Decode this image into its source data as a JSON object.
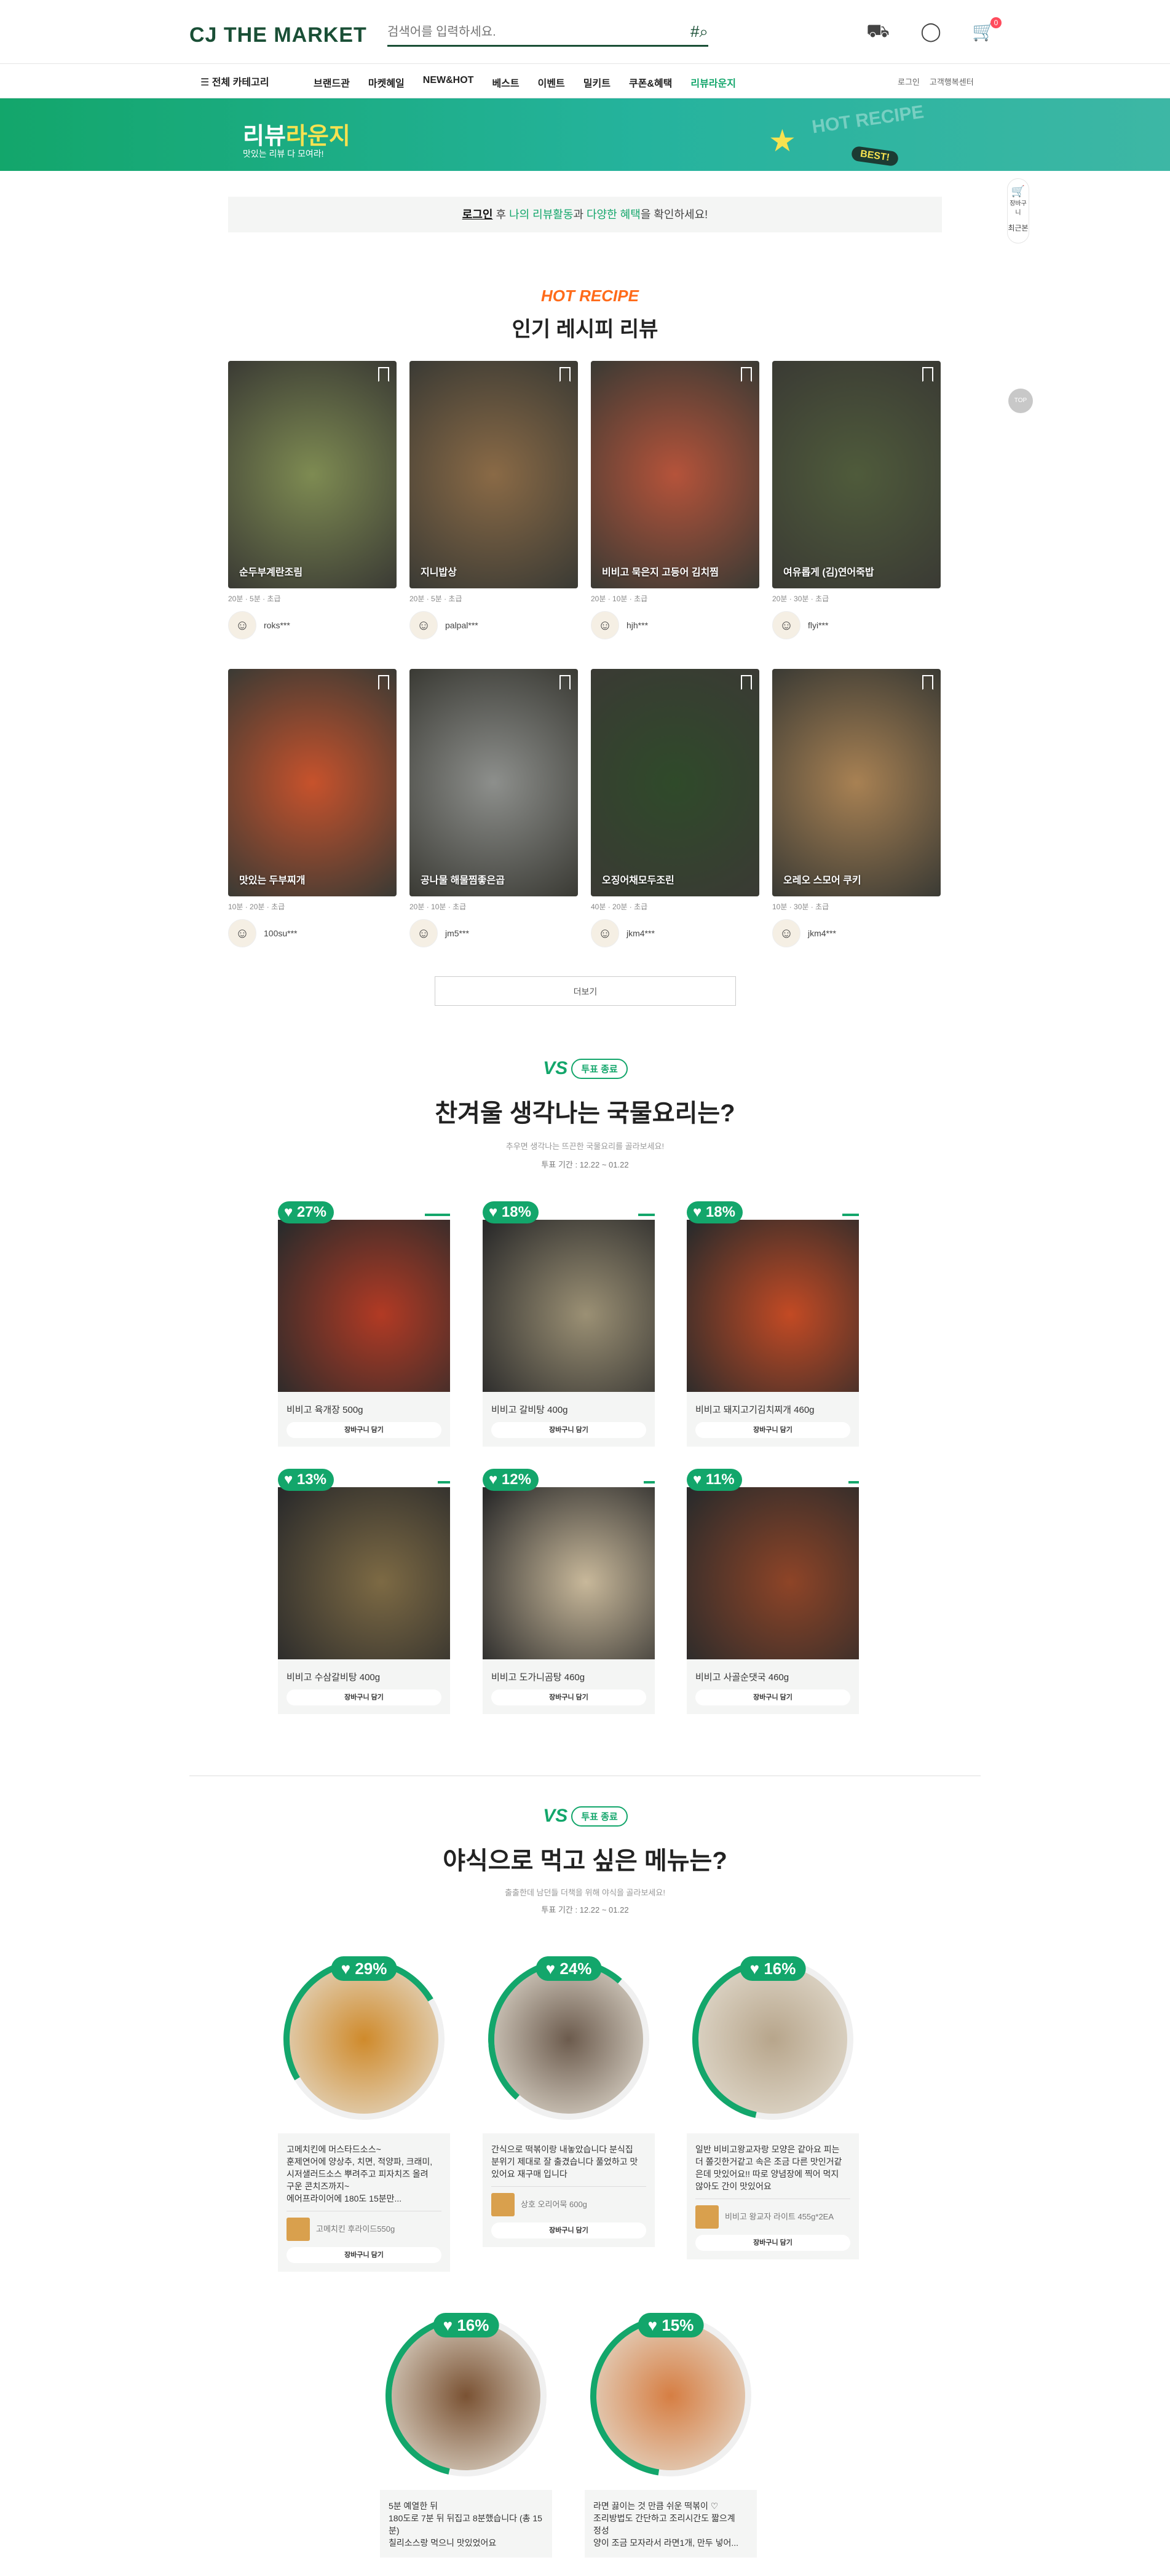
{
  "header": {
    "logo": "CJ THE MARKET",
    "search_placeholder": "검색어를 입력하세요.",
    "cart_count": "0",
    "recent_label": "최근"
  },
  "gnb": {
    "all": "전체 카테고리",
    "menu": [
      "브랜드관",
      "마켓혜일",
      "NEW&HOT",
      "베스트",
      "이벤트",
      "밀키트",
      "쿠폰&혜택"
    ],
    "lounge": "리뷰라운지",
    "login": "로그인",
    "cs": "고객행복센터"
  },
  "banner": {
    "title_a": "리뷰",
    "title_b": "라운지",
    "subtitle": "맛있는 리뷰 다 모여라!",
    "hot": "HOT RECIPE",
    "best": "BEST!"
  },
  "quick": {
    "cart": "장바구니",
    "recent": "최근본",
    "top": "TOP"
  },
  "login_bar": {
    "link": "로그인",
    "t1": "후 ",
    "g1": "나의 리뷰활동",
    "t2": "과 ",
    "g2": "다양한 혜택",
    "t3": "을 확인하세요!"
  },
  "recipe": {
    "hot": "HOT RECIPE",
    "title": "인기 레시피 리뷰",
    "more": "더보기",
    "items": [
      {
        "name": "순두부계란조림",
        "meta": "20분 · 5분 · 초급",
        "user": "roks***",
        "color": "#7e8b52"
      },
      {
        "name": "지니밥상",
        "meta": "20분 · 5분 · 초급",
        "user": "palpal***",
        "color": "#8a6a46"
      },
      {
        "name": "비비고 묵은지 고등어 김치찜",
        "meta": "20분 · 10분 · 초급",
        "user": "hjh***",
        "color": "#b5533a"
      },
      {
        "name": "여유롭게 (김)연어죽밥",
        "meta": "20분 · 30분 · 초급",
        "user": "flyi***",
        "color": "#4f5b3b"
      },
      {
        "name": "맛있는 두부찌개",
        "meta": "10분 · 20분 · 초급",
        "user": "100su***",
        "color": "#c7522c"
      },
      {
        "name": "공나물 해물찜좋은곱",
        "meta": "20분 · 10분 · 초급",
        "user": "jm5***",
        "color": "#8d8f8c"
      },
      {
        "name": "오징어채모두조린",
        "meta": "40분 · 20분 · 초급",
        "user": "jkm4***",
        "color": "#2f4a2a"
      },
      {
        "name": "오레오 스모어 쿠키",
        "meta": "10분 · 30분 · 초급",
        "user": "jkm4***",
        "color": "#a88153"
      }
    ]
  },
  "vote1": {
    "status": "투표 종료",
    "question": "찬겨울 생각나는 국물요리는?",
    "subtitle": "추우면 생각나는 뜨끈한 국물요리를 골라보세요!",
    "period": "투표 기간 : 12.22 ~ 01.22",
    "btn": "장바구니 담기",
    "items": [
      {
        "pct": "27%",
        "value": 27,
        "name": "비비고 육개장 500g",
        "color": "#b23a24"
      },
      {
        "pct": "18%",
        "value": 18,
        "name": "비비고 갈비탕 400g",
        "color": "#9b9074"
      },
      {
        "pct": "18%",
        "value": 18,
        "name": "비비고 돼지고기김치찌개 460g",
        "color": "#c34a24"
      },
      {
        "pct": "13%",
        "value": 13,
        "name": "비비고 수삼갈비탕 400g",
        "color": "#7d6a44"
      },
      {
        "pct": "12%",
        "value": 12,
        "name": "비비고 도가니곰탕 460g",
        "color": "#c8b89a"
      },
      {
        "pct": "11%",
        "value": 11,
        "name": "비비고 사골순댓국 460g",
        "color": "#8e4427"
      }
    ]
  },
  "vote2": {
    "status": "투표 종료",
    "question": "야식으로 먹고 싶은 메뉴는?",
    "subtitle": "출출한데 남던들 더책을 위해 야식을 골라보세요!",
    "period": "투표 기간 : 12.22 ~ 01.22",
    "btn": "장바구니 담기",
    "items": [
      {
        "pct": "29%",
        "value": 29,
        "desc": "고메치킨에 머스타드소스~\n훈제연어에 양상추, 치면, 적양파, 크래미,\n시저샐러드소스 뿌려주고 피자치즈 올려\n구운 콘치즈까지~\n에어프라이어에 180도 15분만...",
        "prod": "고메치킨 후라이드550g",
        "color": "#cf8a2b"
      },
      {
        "pct": "24%",
        "value": 24,
        "desc": "간식으로 떡볶이랑 내놓았습니다 분식집\n분위기 제대로 잘 출겼습니다 풀었하고 맛\n있어요 재구매 입니다",
        "prod": "상호 오리어묵 600g",
        "color": "#6c5b4d"
      },
      {
        "pct": "16%",
        "value": 16,
        "desc": "일반 비비고왕교자랑 모양은 같아요 피는\n더 쫄깃한거같고 속은 조금 다른 맛인거같\n은데 맛있어요!! 따로 양념장에 찍어 먹지\n않아도 간이 맛있어요",
        "prod": "비비고 왕교자 라이트 455g*2EA",
        "color": "#b7a58b"
      },
      {
        "pct": "16%",
        "value": 16,
        "desc": "5분 예열한 뒤\n180도로 7분 뒤 뒤집고 8분했습니다 (총 15분)\n칠리소스랑 먹으니 맛있었어요",
        "prod": "",
        "color": "#7a5233"
      },
      {
        "pct": "15%",
        "value": 15,
        "desc": "라면 끓이는 것 만큼 쉬운 떡볶이 ♡\n조리방법도 간단하고 조리시간도 짧으계\n정성\n양이 조금 모자라서 라면1개, 만두 넣어...",
        "prod": "",
        "color": "#d67e43"
      }
    ]
  }
}
